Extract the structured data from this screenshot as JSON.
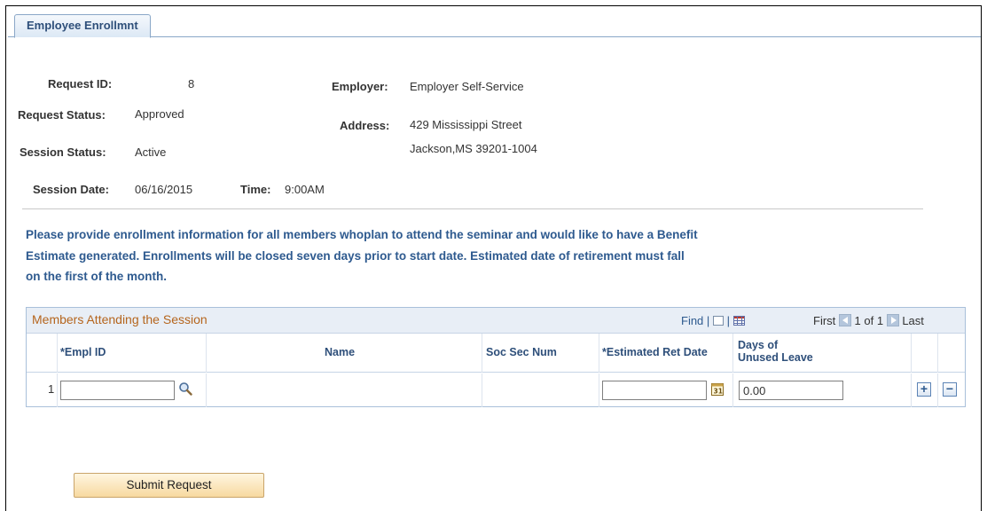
{
  "tab": {
    "label": "Employee Enrollmnt"
  },
  "info": {
    "request_id_label": "Request ID:",
    "request_id": "8",
    "request_status_label": "Request Status:",
    "request_status": "Approved",
    "session_status_label": "Session Status:",
    "session_status": "Active",
    "session_date_label": "Session Date:",
    "session_date": "06/16/2015",
    "time_label": "Time:",
    "time": "9:00AM",
    "employer_label": "Employer:",
    "employer": "Employer Self-Service",
    "address_label": "Address:",
    "address_line1": "429 Mississippi Street",
    "address_line2": "Jackson,MS 39201-1004"
  },
  "message": {
    "line1": "Please provide enrollment information for all members whoplan to attend the seminar and would like to have a Benefit",
    "line2": "Estimate generated. Enrollments will be closed seven days prior to start date. Estimated date of retirement must fall",
    "line3": "on the first of the month."
  },
  "grid": {
    "title": "Members Attending the Session",
    "find": "Find",
    "sep": "|",
    "first": "First",
    "pager": "1 of 1",
    "last": "Last",
    "columns": {
      "empl_id": "*Empl ID",
      "name": "Name",
      "ssn": "Soc Sec Num",
      "ret_date": "*Estimated Ret Date",
      "unused_leave_1": "Days of",
      "unused_leave_2": "Unused Leave"
    },
    "rows": [
      {
        "num": "1",
        "empl_id": "",
        "name": "",
        "ssn": "",
        "ret_date": "",
        "unused_leave": "0.00"
      }
    ]
  },
  "actions": {
    "submit": "Submit Request",
    "add": "+",
    "delete": "−"
  },
  "colors": {
    "accent": "#2e5a8f",
    "grid_title": "#b5651d",
    "button": "#f7d9a0"
  }
}
